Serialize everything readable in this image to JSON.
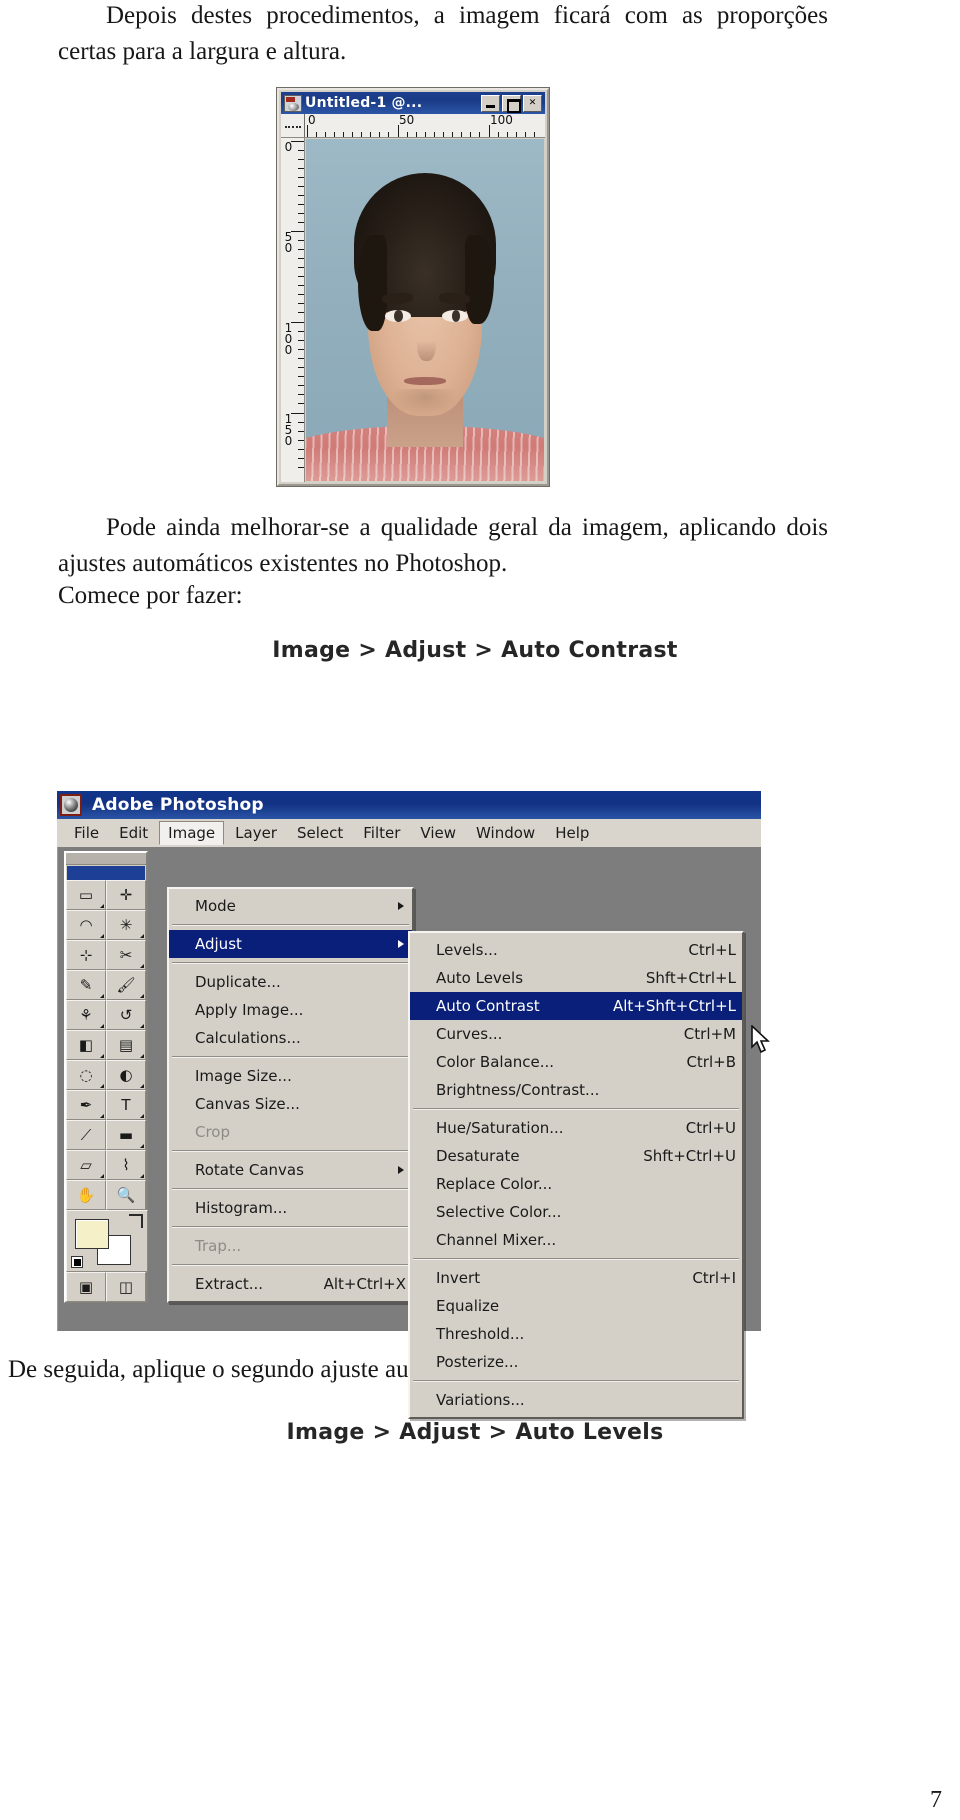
{
  "document": {
    "paragraph_1": "Depois destes procedimentos, a imagem ficará com as proporções certas para a largura e altura.",
    "paragraph_2": "Pode ainda melhorar-se a qualidade geral da imagem, aplicando dois ajustes automáticos existentes no Photoshop.",
    "paragraph_3": "Comece por fazer:",
    "command_1": "Image > Adjust > Auto Contrast",
    "paragraph_4": "De seguida, aplique o segundo ajuste automático:",
    "command_2": "Image > Adjust > Auto Levels",
    "page_number": "7"
  },
  "doc_window": {
    "title": "Untitled-1 @...",
    "icon": "photoshop-document-icon",
    "buttons": [
      {
        "name": "minimize",
        "glyph": "_"
      },
      {
        "name": "maximize",
        "glyph": "□"
      },
      {
        "name": "close",
        "glyph": "✕"
      }
    ],
    "ruler_h": {
      "labels": [
        "0",
        "50",
        "100"
      ]
    },
    "ruler_v": {
      "labels": [
        "0",
        "50",
        "100",
        "150"
      ]
    }
  },
  "photoshop": {
    "app_title": "Adobe Photoshop",
    "logo": "adobe-photoshop-logo-icon",
    "menubar": [
      "File",
      "Edit",
      "Image",
      "Layer",
      "Select",
      "Filter",
      "View",
      "Window",
      "Help"
    ],
    "active_menu": "Image",
    "mini_doc_label": "150",
    "image_menu": [
      {
        "label": "Mode",
        "accel": "",
        "submenu": true,
        "selected": false,
        "disabled": false
      },
      {
        "separator": true
      },
      {
        "label": "Adjust",
        "accel": "",
        "submenu": true,
        "selected": true,
        "disabled": false
      },
      {
        "separator": true
      },
      {
        "label": "Duplicate...",
        "accel": "",
        "submenu": false,
        "selected": false,
        "disabled": false
      },
      {
        "label": "Apply Image...",
        "accel": "",
        "submenu": false,
        "selected": false,
        "disabled": false
      },
      {
        "label": "Calculations...",
        "accel": "",
        "submenu": false,
        "selected": false,
        "disabled": false
      },
      {
        "separator": true
      },
      {
        "label": "Image Size...",
        "accel": "",
        "submenu": false,
        "selected": false,
        "disabled": false
      },
      {
        "label": "Canvas Size...",
        "accel": "",
        "submenu": false,
        "selected": false,
        "disabled": false
      },
      {
        "label": "Crop",
        "accel": "",
        "submenu": false,
        "selected": false,
        "disabled": true
      },
      {
        "separator": true
      },
      {
        "label": "Rotate Canvas",
        "accel": "",
        "submenu": true,
        "selected": false,
        "disabled": false
      },
      {
        "separator": true
      },
      {
        "label": "Histogram...",
        "accel": "",
        "submenu": false,
        "selected": false,
        "disabled": false
      },
      {
        "separator": true
      },
      {
        "label": "Trap...",
        "accel": "",
        "submenu": false,
        "selected": false,
        "disabled": true
      },
      {
        "separator": true
      },
      {
        "label": "Extract...",
        "accel": "Alt+Ctrl+X",
        "submenu": false,
        "selected": false,
        "disabled": false
      }
    ],
    "adjust_submenu": [
      {
        "label": "Levels...",
        "accel": "Ctrl+L",
        "selected": false
      },
      {
        "label": "Auto Levels",
        "accel": "Shft+Ctrl+L",
        "selected": false
      },
      {
        "label": "Auto Contrast",
        "accel": "Alt+Shft+Ctrl+L",
        "selected": true
      },
      {
        "label": "Curves...",
        "accel": "Ctrl+M",
        "selected": false
      },
      {
        "label": "Color Balance...",
        "accel": "Ctrl+B",
        "selected": false
      },
      {
        "label": "Brightness/Contrast...",
        "accel": "",
        "selected": false
      },
      {
        "separator": true
      },
      {
        "label": "Hue/Saturation...",
        "accel": "Ctrl+U",
        "selected": false
      },
      {
        "label": "Desaturate",
        "accel": "Shft+Ctrl+U",
        "selected": false
      },
      {
        "label": "Replace Color...",
        "accel": "",
        "selected": false
      },
      {
        "label": "Selective Color...",
        "accel": "",
        "selected": false
      },
      {
        "label": "Channel Mixer...",
        "accel": "",
        "selected": false
      },
      {
        "separator": true
      },
      {
        "label": "Invert",
        "accel": "Ctrl+I",
        "selected": false
      },
      {
        "label": "Equalize",
        "accel": "",
        "selected": false
      },
      {
        "label": "Threshold...",
        "accel": "",
        "selected": false
      },
      {
        "label": "Posterize...",
        "accel": "",
        "selected": false
      },
      {
        "separator": true
      },
      {
        "label": "Variations...",
        "accel": "",
        "selected": false
      }
    ],
    "toolbox_tools": [
      "marquee-tool-icon",
      "move-tool-icon",
      "lasso-tool-icon",
      "magic-wand-tool-icon",
      "crop-tool-icon",
      "slice-tool-icon",
      "healing-brush-tool-icon",
      "paintbrush-tool-icon",
      "stamp-tool-icon",
      "history-brush-tool-icon",
      "eraser-tool-icon",
      "gradient-tool-icon",
      "blur-tool-icon",
      "dodge-tool-icon",
      "pen-tool-icon",
      "type-tool-icon",
      "path-selection-tool-icon",
      "rectangle-tool-icon",
      "notes-tool-icon",
      "eyedropper-tool-icon",
      "hand-tool-icon",
      "zoom-tool-icon"
    ]
  },
  "colors": {
    "title_blue": "#12368c",
    "menu_face": "#d4d0c8",
    "menu_highlight": "#0a1f7a",
    "workspace_grey": "#7d7d7d"
  }
}
